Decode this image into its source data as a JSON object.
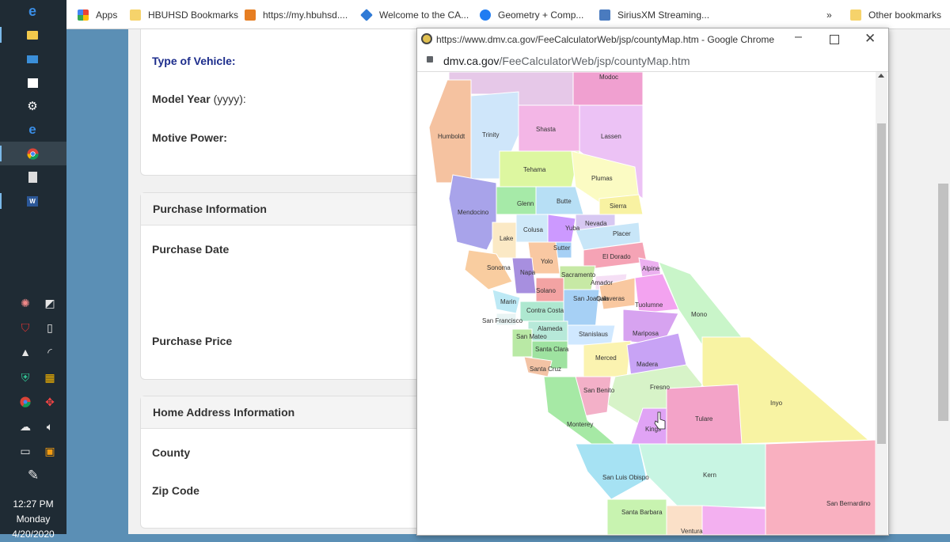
{
  "taskbar": {
    "clock_time": "12:27 PM",
    "clock_day": "Monday",
    "clock_date": "4/20/2020"
  },
  "bookmarks": {
    "items": [
      "Apps",
      "HBUHSD Bookmarks",
      "https://my.hbuhsd....",
      "Welcome to the CA...",
      "Geometry + Comp...",
      "SiriusXM Streaming..."
    ],
    "overflow": "»",
    "other": "Other bookmarks"
  },
  "form": {
    "type_of_vehicle": "Type of Vehicle:",
    "model_year": "Model Year",
    "model_year_hint": "(yyyy):",
    "motive_power": "Motive Power:",
    "purchase_header": "Purchase Information",
    "purchase_date": "Purchase Date",
    "purchase_price": "Purchase Price",
    "home_header": "Home Address Information",
    "county": "County",
    "zip_code": "Zip Code"
  },
  "popup": {
    "title": "https://www.dmv.ca.gov/FeeCalculatorWeb/jsp/countyMap.htm - Google Chrome",
    "url_domain": "dmv.ca.gov",
    "url_path": "/FeeCalculatorWeb/jsp/countyMap.htm"
  },
  "map": {
    "counties": [
      "Modoc",
      "Shasta",
      "Trinity",
      "Humboldt",
      "Lassen",
      "Tehama",
      "Plumas",
      "Glenn",
      "Butte",
      "Sierra",
      "Mendocino",
      "Nevada",
      "Colusa",
      "Yuba",
      "Placer",
      "Lake",
      "Sutter",
      "El Dorado",
      "Yolo",
      "Sonoma",
      "Napa",
      "Alpine",
      "Sacramento",
      "Amador",
      "Solano",
      "Marin",
      "San Joaquin",
      "Calaveras",
      "Tuolumne",
      "Mono",
      "Contra Costa",
      "San Francisco",
      "Alameda",
      "Stanislaus",
      "Mariposa",
      "San Mateo",
      "Santa Clara",
      "Merced",
      "Madera",
      "Santa Cruz",
      "Fresno",
      "Inyo",
      "San Benito",
      "Tulare",
      "Monterey",
      "Kings",
      "Kern",
      "San Luis Obispo",
      "San Bernardino",
      "Santa Barbara",
      "Ventura"
    ]
  }
}
